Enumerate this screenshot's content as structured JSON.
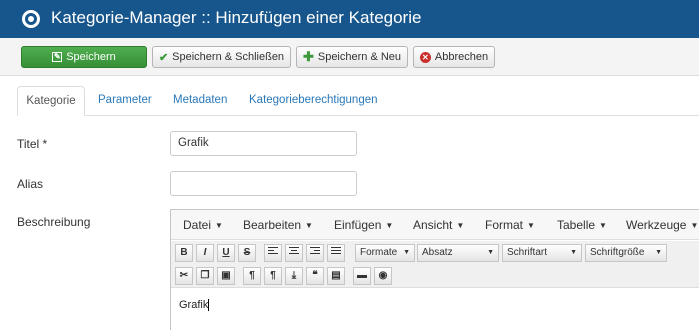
{
  "header": {
    "title": "Kategorie-Manager :: Hinzufügen einer Kategorie"
  },
  "toolbar": {
    "save_label": "Speichern",
    "save_close_label": "Speichern & Schließen",
    "save_new_label": "Speichern & Neu",
    "cancel_label": "Abbrechen"
  },
  "tabs": [
    "Kategorie",
    "Parameter",
    "Metadaten",
    "Kategorieberechtigungen"
  ],
  "form": {
    "title_label": "Titel *",
    "title_value": "Grafik",
    "alias_label": "Alias",
    "alias_value": "",
    "description_label": "Beschreibung"
  },
  "editor": {
    "menus": [
      "Datei",
      "Bearbeiten",
      "Einfügen",
      "Ansicht",
      "Format",
      "Tabelle",
      "Werkzeuge"
    ],
    "buttons": {
      "bold": "B",
      "italic": "I",
      "underline": "U",
      "strike": "S"
    },
    "selects": {
      "formats": "Formate",
      "paragraph": "Absatz",
      "font": "Schriftart",
      "size": "Schriftgröße"
    },
    "content": "Grafik"
  }
}
